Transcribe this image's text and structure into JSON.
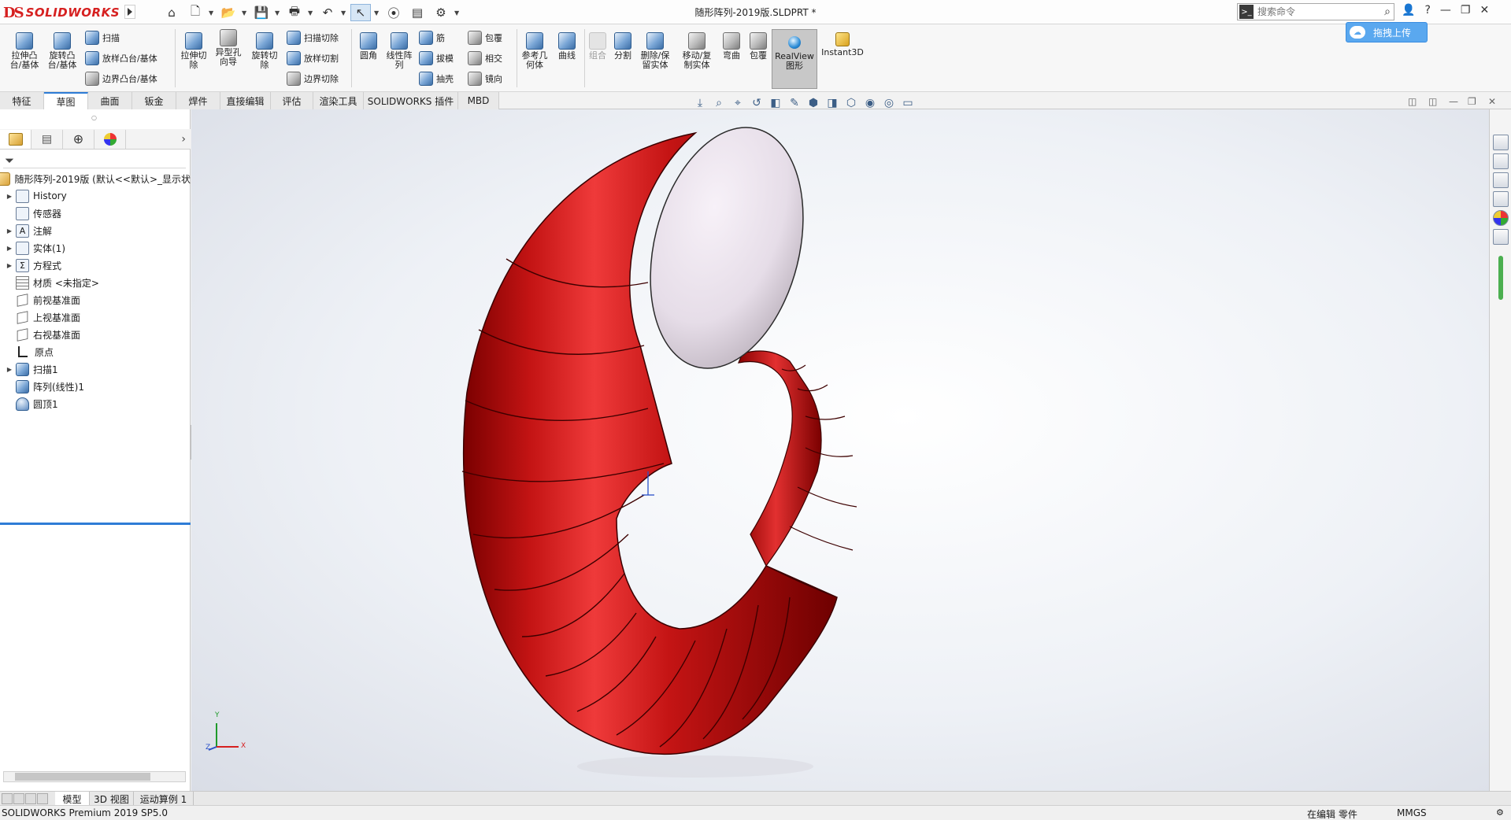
{
  "app": {
    "logo_ds": "DS",
    "logo_text": "SOLIDWORKS",
    "document_title": "随形阵列-2019版.SLDPRT *"
  },
  "search": {
    "placeholder": "搜索命令"
  },
  "upload": {
    "label": "拖拽上传"
  },
  "ribbon": {
    "extrude_boss": "拉伸凸\n台/基体",
    "revolve_boss": "旋转凸\n台/基体",
    "sweep": "扫描",
    "loft_boss": "放样凸台/基体",
    "boundary_boss": "边界凸台/基体",
    "extrude_cut": "拉伸切\n除",
    "hole_wizard": "异型孔\n向导",
    "revolve_cut": "旋转切\n除",
    "swept_cut": "扫描切除",
    "lofted_cut": "放样切割",
    "boundary_cut": "边界切除",
    "fillet": "圆角",
    "linear_pattern": "线性阵\n列",
    "rib": "筋",
    "draft": "拔模",
    "shell": "抽壳",
    "wrap": "包覆",
    "intersect": "相交",
    "mirror": "镜向",
    "ref_geometry": "参考几\n何体",
    "curves": "曲线",
    "combine": "组合",
    "split": "分割",
    "delete_keep_body": "删除/保\n留实体",
    "move_copy_body": "移动/复\n制实体",
    "flex": "弯曲",
    "wrap2": "包覆",
    "realview": "RealView\n图形",
    "instant3d": "Instant3D"
  },
  "tabs": [
    "特征",
    "草图",
    "曲面",
    "钣金",
    "焊件",
    "直接编辑",
    "评估",
    "渲染工具",
    "SOLIDWORKS 插件",
    "MBD"
  ],
  "tree": {
    "root": "随形阵列-2019版 (默认<<默认>_显示状",
    "items": [
      {
        "label": "History",
        "expandable": true
      },
      {
        "label": "传感器",
        "expandable": false
      },
      {
        "label": "注解",
        "expandable": true
      },
      {
        "label": "实体(1)",
        "expandable": true
      },
      {
        "label": "方程式",
        "expandable": true
      },
      {
        "label": "材质 <未指定>",
        "expandable": false
      },
      {
        "label": "前视基准面",
        "expandable": false
      },
      {
        "label": "上视基准面",
        "expandable": false
      },
      {
        "label": "右视基准面",
        "expandable": false
      },
      {
        "label": "原点",
        "expandable": false
      },
      {
        "label": "扫描1",
        "expandable": true
      },
      {
        "label": "阵列(线性)1",
        "expandable": false
      },
      {
        "label": "圆顶1",
        "expandable": false
      }
    ]
  },
  "triad": {
    "x": "X",
    "y": "Y",
    "z": "Z"
  },
  "bottom_tabs": [
    "模型",
    "3D 视图",
    "运动算例 1"
  ],
  "status": {
    "product": "SOLIDWORKS Premium 2019 SP5.0",
    "editing": "在编辑 零件",
    "units": "MMGS"
  },
  "colors": {
    "part_red": "#c41414",
    "dome": "#e6dde8",
    "accent": "#2e7cd6",
    "logo_red": "#d62020"
  }
}
